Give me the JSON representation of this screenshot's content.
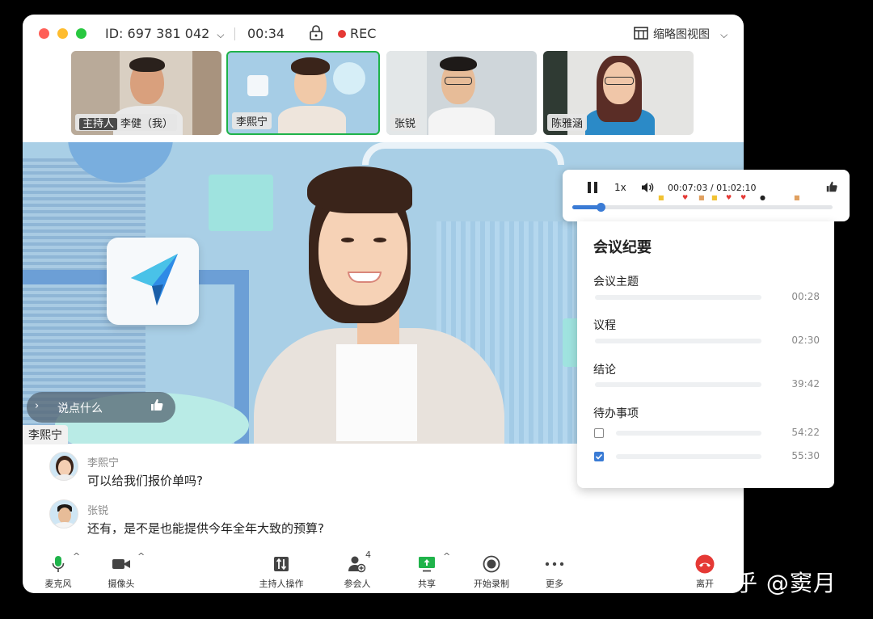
{
  "titlebar": {
    "meeting_id": "ID: 697 381 042",
    "timer": "00:34",
    "rec_label": "REC",
    "view_mode": "缩略图视图"
  },
  "participants": [
    {
      "name": "李健（我）",
      "tag": "主持人"
    },
    {
      "name": "李熙宁"
    },
    {
      "name": "张锐"
    },
    {
      "name": "陈雅涵"
    }
  ],
  "stage": {
    "speaker": "李熙宁",
    "say_placeholder": "说点什么"
  },
  "captions": [
    {
      "name": "李熙宁",
      "text": "可以给我们报价单吗?"
    },
    {
      "name": "张锐",
      "text": "还有，是不是也能提供今年全年大致的预算?"
    }
  ],
  "toolbar": {
    "mic": "麦克风",
    "camera": "摄像头",
    "host_ops": "主持人操作",
    "participants": "参会人",
    "participants_count": "4",
    "share": "共享",
    "record": "开始录制",
    "more": "更多",
    "leave": "离开"
  },
  "player": {
    "speed": "1x",
    "time": "00:07:03 / 01:02:10",
    "progress": 0.11
  },
  "minutes": {
    "title": "会议纪要",
    "sections": [
      {
        "label": "会议主题",
        "time": "00:28"
      },
      {
        "label": "议程",
        "time": "02:30"
      },
      {
        "label": "结论",
        "time": "39:42"
      },
      {
        "label": "待办事项",
        "items": [
          {
            "time": "54:22",
            "checked": false
          },
          {
            "time": "55:30",
            "checked": true
          }
        ]
      }
    ]
  },
  "watermark": "知乎 @窦月",
  "colors": {
    "accent_blue": "#3a7bd5",
    "green": "#1fb34a",
    "rec_red": "#e53935",
    "leave_red": "#e53935"
  }
}
